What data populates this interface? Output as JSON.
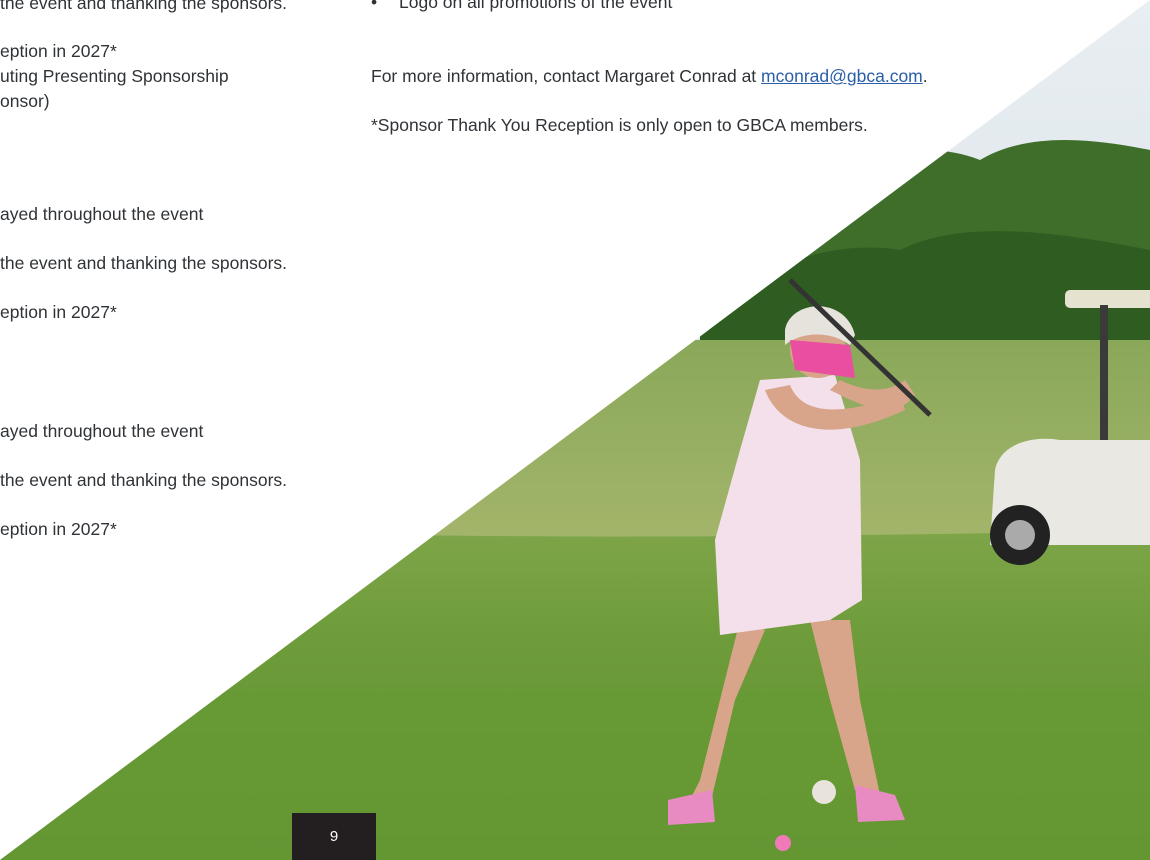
{
  "left_column": {
    "line1": "the event and thanking the sponsors.",
    "line2": "eption in 2027*",
    "line3": "uting Presenting Sponsorship",
    "line4": "onsor)",
    "line5": "ayed throughout the event",
    "line6": "the event and thanking the sponsors.",
    "line7": "eption in 2027*",
    "line8": "ayed throughout the event",
    "line9": "the event and thanking the sponsors.",
    "line10": "eption in 2027*"
  },
  "right_column": {
    "bullet": "Logo on all promotions of the event",
    "contact_prefix": "For more information, contact Margaret Conrad at ",
    "contact_email": "mconrad@gbca.com",
    "contact_suffix": ".",
    "footnote": "*Sponsor Thank You Reception is only open to GBCA members."
  },
  "page_number": "9",
  "photo": {
    "subject": "woman golfer teeing off with golf cart behind"
  }
}
